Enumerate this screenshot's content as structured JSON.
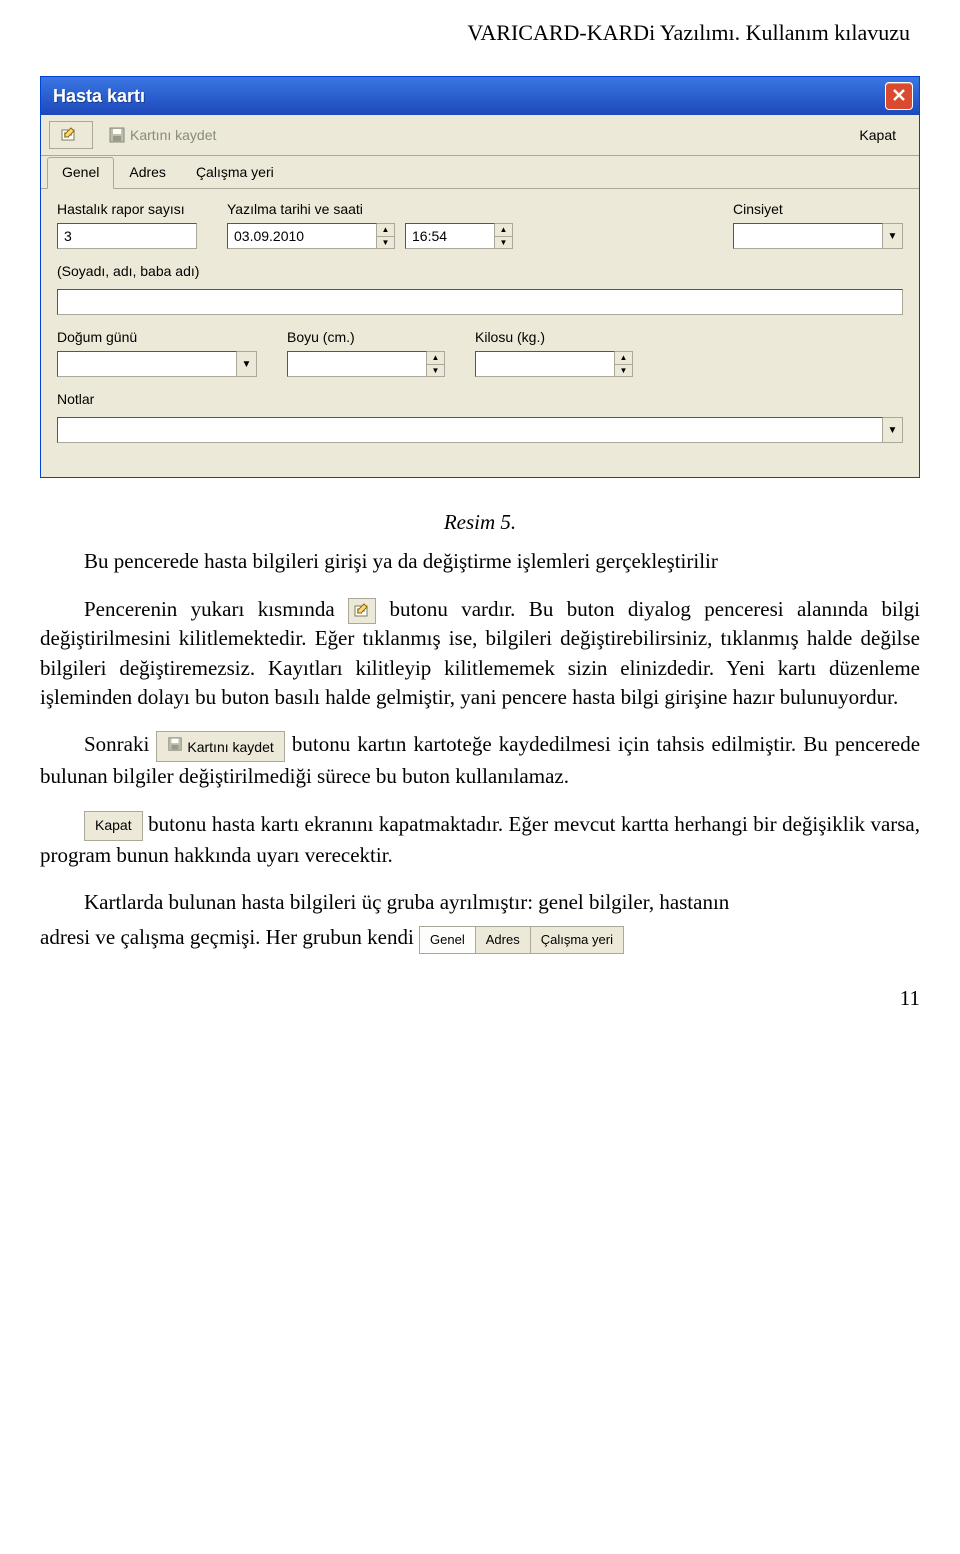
{
  "doc": {
    "header": "VARICARD-KARDi Yazılımı. Kullanım kılavuzu",
    "caption": "Resim 5.",
    "paragraphs": {
      "p1a": "Bu pencerede hasta bilgileri girişi ya da değiştirme işlemleri gerçekleştirilir",
      "p1b_pre": "Pencerenin yukarı kısmında ",
      "p1b_post": "butonu vardır. Bu buton diyalog penceresi alanında bilgi değiştirilmesini kilitlemektedir. Eğer tıklanmış ise, bilgileri değiştirebilirsiniz, tıklanmış halde değilse bilgileri değiştiremezsiz. Kayıtları kilitleyip kilitlememek sizin elinizdedir. Yeni kartı düzenleme işleminden dolayı bu buton basılı halde gelmiştir, yani pencere hasta bilgi girişine hazır bulunuyordur.",
      "p2_pre": "Sonraki ",
      "p2_mid": " butonu kartın kartoteğe kaydedilmesi için tahsis edilmiştir. Bu pencerede bulunan bilgiler değiştirilmediği sürece bu buton kullanılamaz.",
      "p3_post": "butonu hasta kartı ekranını kapatmaktadır. Eğer mevcut kartta herhangi bir değişiklik varsa, program bunun hakkında uyarı verecektir.",
      "p4_pre": "Kartlarda bulunan hasta bilgileri üç gruba ayrılmıştır: genel bilgiler, hastanın",
      "p4_line2_pre": "adresi ve çalışma geçmişi. Her grubun kendi "
    },
    "inline_buttons": {
      "save_label": "Kartını kaydet",
      "close_label": "Kapat",
      "tabs": {
        "t1": "Genel",
        "t2": "Adres",
        "t3": "Çalışma yeri"
      }
    },
    "page_num": "11"
  },
  "dialog": {
    "title": "Hasta kartı",
    "toolbar": {
      "save_label": "Kartını kaydet",
      "close_label": "Kapat"
    },
    "tabs": {
      "t1": "Genel",
      "t2": "Adres",
      "t3": "Çalışma yeri"
    },
    "fields": {
      "report_no_label": "Hastalık rapor sayısı",
      "report_no_value": "3",
      "datetime_label": "Yazılma tarihi ve saati",
      "date_value": "03.09.2010",
      "time_value": "16:54",
      "gender_label": "Cinsiyet",
      "gender_value": "",
      "fullname_label": "(Soyadı, adı, baba adı)",
      "fullname_value": "",
      "birth_label": "Doğum günü",
      "birth_value": "",
      "height_label": "Boyu (cm.)",
      "height_value": "",
      "weight_label": "Kilosu (kg.)",
      "weight_value": "",
      "notes_label": "Notlar",
      "notes_value": ""
    }
  }
}
